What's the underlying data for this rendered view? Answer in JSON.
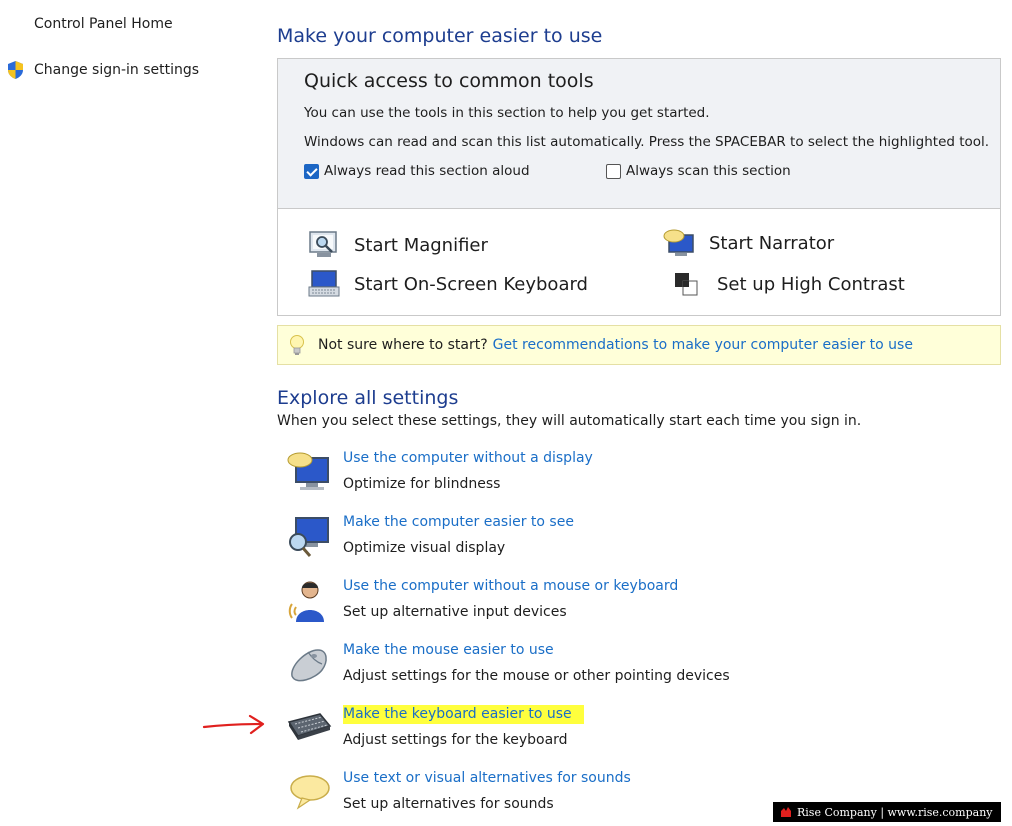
{
  "nav": {
    "home": "Control Panel Home",
    "signin": "Change sign-in settings"
  },
  "main": {
    "title": "Make your computer easier to use"
  },
  "quick_access": {
    "title": "Quick access to common tools",
    "line1": "You can use the tools in this section to help you get started.",
    "line2": "Windows can read and scan this list automatically.  Press the SPACEBAR to select the highlighted tool.",
    "checkbox_read": {
      "label": "Always read this section aloud",
      "checked": true
    },
    "checkbox_scan": {
      "label": "Always scan this section",
      "checked": false
    },
    "tools": {
      "magnifier": "Start Magnifier",
      "narrator": "Start Narrator",
      "keyboard": "Start On-Screen Keyboard",
      "contrast": "Set up High Contrast"
    }
  },
  "hint": {
    "text": "Not sure where to start?",
    "link": "Get recommendations to make your computer easier to use"
  },
  "explore": {
    "title": "Explore all settings",
    "desc": "When you select these settings, they will automatically start each time you sign in.",
    "items": [
      {
        "link": "Use the computer without a display",
        "desc": "Optimize for blindness",
        "icon": "display-speech-icon"
      },
      {
        "link": "Make the computer easier to see",
        "desc": "Optimize visual display",
        "icon": "monitor-magnifier-icon"
      },
      {
        "link": "Use the computer without a mouse or keyboard",
        "desc": "Set up alternative input devices",
        "icon": "person-headset-icon"
      },
      {
        "link": "Make the mouse easier to use",
        "desc": "Adjust settings for the mouse or other pointing devices",
        "icon": "mouse-icon"
      },
      {
        "link": "Make the keyboard easier to use",
        "desc": "Adjust settings for the keyboard",
        "icon": "keyboard-icon"
      },
      {
        "link": "Use text or visual alternatives for sounds",
        "desc": "Set up alternatives for sounds",
        "icon": "speech-bubble-icon"
      }
    ]
  },
  "watermark": {
    "text": "Rise Company | www.rise.company"
  },
  "colors": {
    "link": "#1a6ec7",
    "heading": "#1d3d8f",
    "highlight": "#ffff3d",
    "hint_bg": "#ffffd9",
    "arrow": "#e0201e"
  }
}
